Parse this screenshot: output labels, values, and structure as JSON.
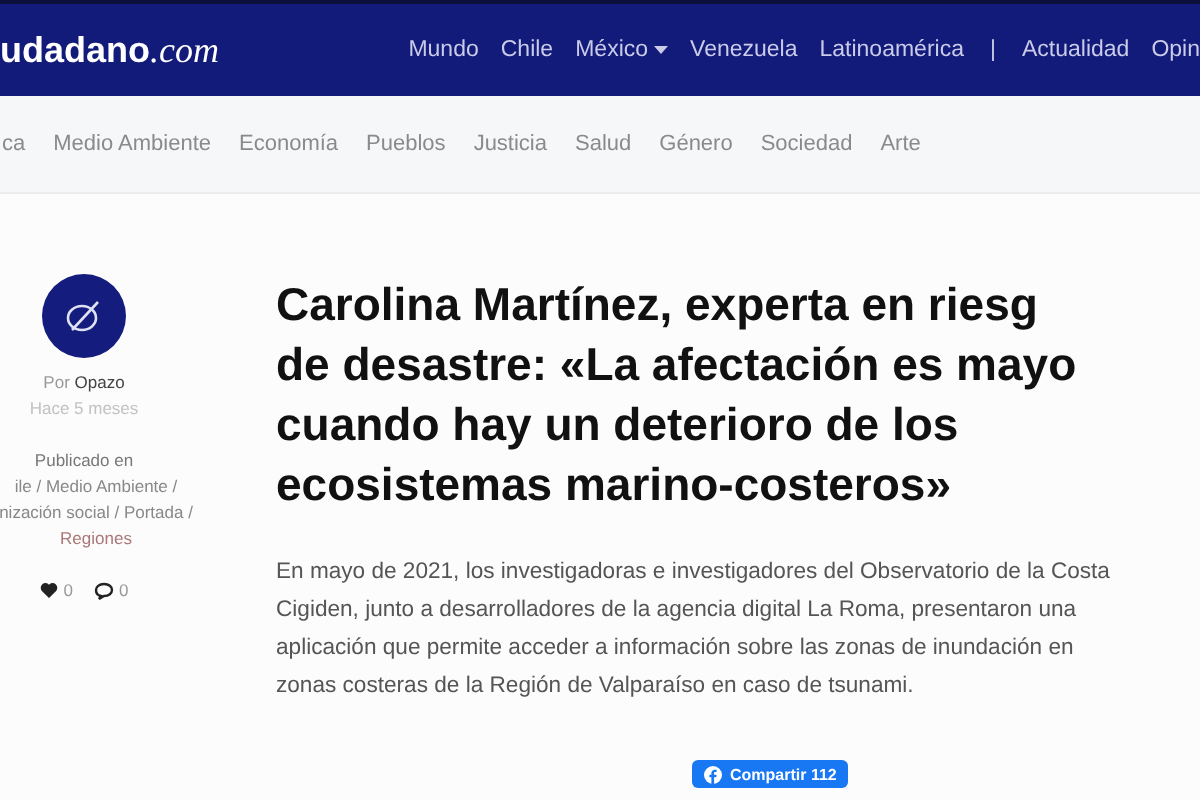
{
  "header": {
    "logo_bold": "udadano",
    "logo_suffix": ".com",
    "nav": [
      {
        "kind": "link",
        "label": "Mundo",
        "dropdown": false
      },
      {
        "kind": "link",
        "label": "Chile",
        "dropdown": false
      },
      {
        "kind": "link",
        "label": "México",
        "dropdown": true
      },
      {
        "kind": "link",
        "label": "Venezuela",
        "dropdown": false
      },
      {
        "kind": "link",
        "label": "Latinoamérica",
        "dropdown": false
      },
      {
        "kind": "divider",
        "label": "|"
      },
      {
        "kind": "link",
        "label": "Actualidad",
        "dropdown": false
      },
      {
        "kind": "link",
        "label": "Opin",
        "dropdown": false
      }
    ]
  },
  "categories": [
    "ca",
    "Medio Ambiente",
    "Economía",
    "Pueblos",
    "Justicia",
    "Salud",
    "Género",
    "Sociedad",
    "Arte"
  ],
  "author": {
    "by": "Por",
    "name": "Opazo",
    "time": "Hace 5 meses",
    "published_label": "Publicado en",
    "published_lines": [
      "ile / Medio Ambiente /",
      "nización social / Portada /",
      "Regiones"
    ],
    "likes": "0",
    "comments": "0"
  },
  "article": {
    "title_lines": [
      "Carolina Martínez, experta en riesg",
      "de desastre: «La afectación es mayo",
      "cuando hay un deterioro de los",
      "ecosistemas marino-costeros»"
    ],
    "paragraph_lines": [
      "En mayo de 2021, los investigadoras e investigadores del Observatorio de la Costa",
      "Cigiden, junto a desarrolladores de la agencia digital La Roma, presentaron una",
      "aplicación que permite acceder a información sobre las zonas de inundación en",
      "zonas costeras de la Región de Valparaíso en caso de tsunami."
    ],
    "share_label": "Compartir",
    "share_count": "112"
  }
}
